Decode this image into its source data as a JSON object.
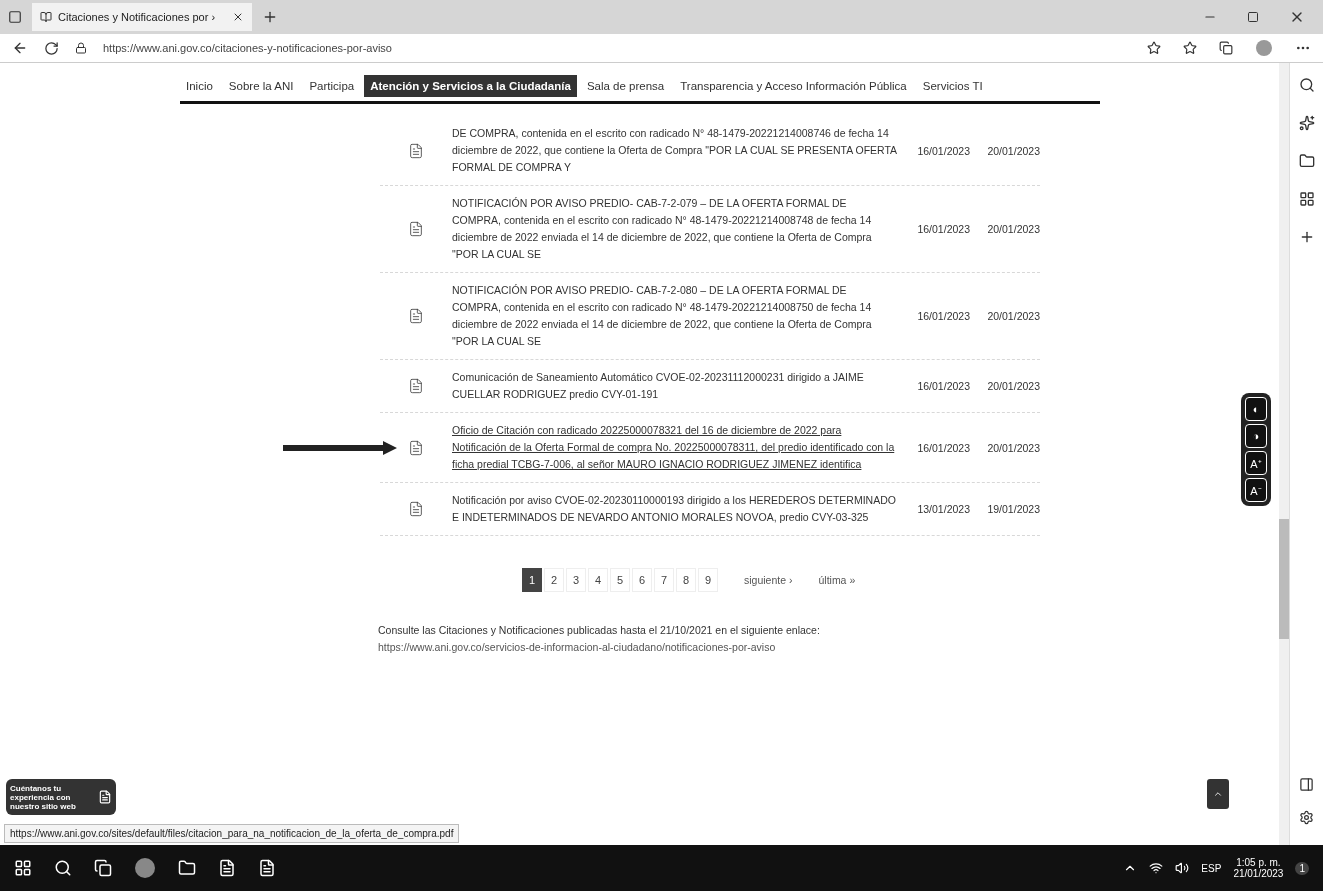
{
  "browser": {
    "tab_title": "Citaciones y Notificaciones por ›",
    "url": "https://www.ani.gov.co/citaciones-y-notificaciones-por-aviso"
  },
  "nav": [
    {
      "label": "Inicio",
      "selected": false
    },
    {
      "label": "Sobre la ANI",
      "selected": false
    },
    {
      "label": "Participa",
      "selected": false
    },
    {
      "label": "Atención y Servicios a la Ciudadanía",
      "selected": true
    },
    {
      "label": "Sala de prensa",
      "selected": false
    },
    {
      "label": "Transparencia y Acceso Información Pública",
      "selected": false
    },
    {
      "label": "Servicios TI",
      "selected": false
    }
  ],
  "rows": [
    {
      "text": "DE COMPRA, contenida en el escrito con radicado N° 48-1479-20221214008746 de fecha 14 diciembre de 2022, que contiene la Oferta de Compra \"POR LA CUAL SE PRESENTA OFERTA FORMAL DE COMPRA Y",
      "link": false,
      "date_1": "16/01/2023",
      "date_2": "20/01/2023"
    },
    {
      "text": "NOTIFICACIÓN POR AVISO PREDIO- CAB-7-2-079 – DE LA OFERTA FORMAL DE COMPRA, contenida en el escrito con radicado N° 48-1479-20221214008748 de fecha 14 diciembre de 2022 enviada el 14 de diciembre de 2022, que contiene la Oferta de Compra \"POR LA CUAL SE",
      "link": false,
      "date_1": "16/01/2023",
      "date_2": "20/01/2023"
    },
    {
      "text": "NOTIFICACIÓN POR AVISO PREDIO- CAB-7-2-080 – DE LA OFERTA FORMAL DE COMPRA, contenida en el escrito con radicado N° 48-1479-20221214008750 de fecha 14 diciembre de 2022 enviada el 14 de diciembre de 2022, que contiene la Oferta de Compra \"POR LA CUAL SE",
      "link": false,
      "date_1": "16/01/2023",
      "date_2": "20/01/2023"
    },
    {
      "text": "Comunicación de Saneamiento Automático CVOE-02-20231112000231 dirigido a JAIME CUELLAR RODRIGUEZ predio CVY-01-191",
      "link": false,
      "date_1": "16/01/2023",
      "date_2": "20/01/2023"
    },
    {
      "text": "Oficio de Citación con radicado 20225000078321 del 16 de diciembre de 2022 para Notificación de la Oferta Formal de compra No. 20225000078311, del predio identificado con la ficha predial TCBG-7-006, al señor MAURO IGNACIO RODRIGUEZ JIMENEZ identifica",
      "link": true,
      "date_1": "16/01/2023",
      "date_2": "20/01/2023"
    },
    {
      "text": "Notificación por aviso CVOE-02-20230110000193 dirigido a los HEREDEROS DETERMINADO E INDETERMINADOS DE NEVARDO ANTONIO MORALES NOVOA, predio CVY-03-325",
      "link": false,
      "date_1": "13/01/2023",
      "date_2": "19/01/2023"
    }
  ],
  "pagination": {
    "pages": [
      {
        "label": "1",
        "selected": true
      },
      {
        "label": "2",
        "selected": false
      },
      {
        "label": "3",
        "selected": false
      },
      {
        "label": "4",
        "selected": false
      },
      {
        "label": "5",
        "selected": false
      },
      {
        "label": "6",
        "selected": false
      },
      {
        "label": "7",
        "selected": false
      },
      {
        "label": "8",
        "selected": false
      },
      {
        "label": "9",
        "selected": false
      }
    ],
    "next": "siguiente ›",
    "last": "última »"
  },
  "footer": {
    "text": "Consulte las Citaciones y Notificaciones publicadas hasta el 21/10/2021 en el siguiente enlace:",
    "link": "https://www.ani.gov.co/servicios-de-informacion-al-ciudadano/notificaciones-por-aviso"
  },
  "accessibility": [
    "◐",
    "◑",
    "A⁺",
    "A⁻"
  ],
  "feedback": "Cuéntanos tu experiencia con nuestro sitio web",
  "status_url": "https://www.ani.gov.co/sites/default/files/citacion_para_na_notificacion_de_la_oferta_de_compra.pdf",
  "taskbar": {
    "language": "ESP",
    "time": "1:05 p. m.",
    "date": "21/01/2023",
    "notifications": "1"
  }
}
